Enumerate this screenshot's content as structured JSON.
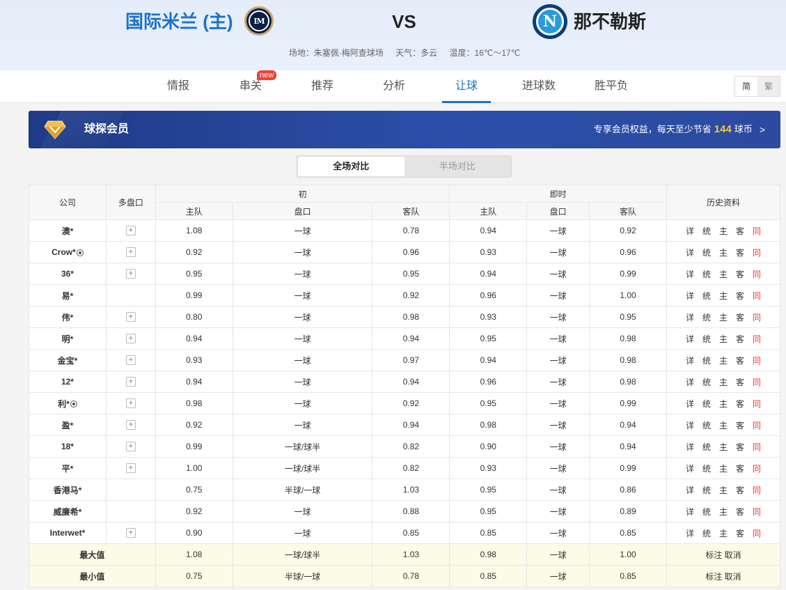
{
  "header": {
    "home_team": "国际米兰 (主)",
    "away_team": "那不勒斯",
    "vs": "VS",
    "home_logo_text": "IM",
    "away_logo_text": "N",
    "venue": "场地：朱塞佩·梅阿查球场",
    "weather": "天气：多云",
    "temperature": "温度：16℃～17℃"
  },
  "nav": {
    "tabs": [
      "情报",
      "串关",
      "推荐",
      "分析",
      "让球",
      "进球数",
      "胜平负"
    ],
    "active_tab": "让球",
    "new_badge": "new",
    "lang_simplified": "简",
    "lang_traditional": "繁"
  },
  "member": {
    "title": "球探会员",
    "text_prefix": "专享会员权益，每天至少节省",
    "coins": "144",
    "text_suffix": "球币",
    "arrow": ">"
  },
  "segment": {
    "full": "全场对比",
    "half": "半场对比"
  },
  "table": {
    "headers": {
      "company": "公司",
      "multi": "多盘口",
      "initial": "初",
      "live": "即时",
      "home": "主队",
      "line": "盘口",
      "away": "客队",
      "history": "历史资料"
    },
    "history_links": [
      "详",
      "统",
      "主",
      "客",
      "同"
    ],
    "rows": [
      {
        "company": "澳*",
        "ball": false,
        "plus": true,
        "i_home": "1.08",
        "i_line": "一球",
        "i_away": "0.78",
        "l_home": "0.94",
        "l_line": "一球",
        "l_away": "0.92"
      },
      {
        "company": "Crow*",
        "ball": true,
        "plus": true,
        "i_home": "0.92",
        "i_line": "一球",
        "i_away": "0.96",
        "l_home": "0.93",
        "l_line": "一球",
        "l_away": "0.96"
      },
      {
        "company": "36*",
        "ball": false,
        "plus": true,
        "i_home": "0.95",
        "i_line": "一球",
        "i_away": "0.95",
        "l_home": "0.94",
        "l_line": "一球",
        "l_away": "0.99"
      },
      {
        "company": "易*",
        "ball": false,
        "plus": false,
        "i_home": "0.99",
        "i_line": "一球",
        "i_away": "0.92",
        "l_home": "0.96",
        "l_line": "一球",
        "l_away": "1.00"
      },
      {
        "company": "伟*",
        "ball": false,
        "plus": true,
        "i_home": "0.80",
        "i_line": "一球",
        "i_away": "0.98",
        "l_home": "0.93",
        "l_line": "一球",
        "l_away": "0.95"
      },
      {
        "company": "明*",
        "ball": false,
        "plus": true,
        "i_home": "0.94",
        "i_line": "一球",
        "i_away": "0.94",
        "l_home": "0.95",
        "l_line": "一球",
        "l_away": "0.98"
      },
      {
        "company": "金宝*",
        "ball": false,
        "plus": true,
        "i_home": "0.93",
        "i_line": "一球",
        "i_away": "0.97",
        "l_home": "0.94",
        "l_line": "一球",
        "l_away": "0.98"
      },
      {
        "company": "12*",
        "ball": false,
        "plus": true,
        "i_home": "0.94",
        "i_line": "一球",
        "i_away": "0.94",
        "l_home": "0.96",
        "l_line": "一球",
        "l_away": "0.98"
      },
      {
        "company": "利*",
        "ball": true,
        "plus": true,
        "i_home": "0.98",
        "i_line": "一球",
        "i_away": "0.92",
        "l_home": "0.95",
        "l_line": "一球",
        "l_away": "0.99"
      },
      {
        "company": "盈*",
        "ball": false,
        "plus": true,
        "i_home": "0.92",
        "i_line": "一球",
        "i_away": "0.94",
        "l_home": "0.98",
        "l_line": "一球",
        "l_away": "0.94"
      },
      {
        "company": "18*",
        "ball": false,
        "plus": true,
        "i_home": "0.99",
        "i_line": "一球/球半",
        "i_away": "0.82",
        "l_home": "0.90",
        "l_line": "一球",
        "l_away": "0.94"
      },
      {
        "company": "平*",
        "ball": false,
        "plus": true,
        "i_home": "1.00",
        "i_line": "一球/球半",
        "i_away": "0.82",
        "l_home": "0.93",
        "l_line": "一球",
        "l_away": "0.99"
      },
      {
        "company": "香港马*",
        "ball": false,
        "plus": false,
        "i_home": "0.75",
        "i_line": "半球/一球",
        "i_away": "1.03",
        "l_home": "0.95",
        "l_line": "一球",
        "l_away": "0.86"
      },
      {
        "company": "威廉希*",
        "ball": false,
        "plus": false,
        "i_home": "0.92",
        "i_line": "一球",
        "i_away": "0.88",
        "l_home": "0.95",
        "l_line": "一球",
        "l_away": "0.89"
      },
      {
        "company": "Interwet*",
        "ball": false,
        "plus": true,
        "i_home": "0.90",
        "i_line": "一球",
        "i_away": "0.85",
        "l_home": "0.85",
        "l_line": "一球",
        "l_away": "0.85"
      }
    ],
    "summary": [
      {
        "label": "最大值",
        "i_home": "1.08",
        "i_line": "一球/球半",
        "i_away": "1.03",
        "l_home": "0.98",
        "l_line": "一球",
        "l_away": "1.00",
        "action": "标注 取消"
      },
      {
        "label": "最小值",
        "i_home": "0.75",
        "i_line": "半球/一球",
        "i_away": "0.78",
        "l_home": "0.85",
        "l_line": "一球",
        "l_away": "0.85",
        "action": "标注 取消"
      }
    ]
  },
  "colors": {
    "accent": "#1a73c9",
    "header_bg": "#e6eefa",
    "banner_bg": "#2a4aa0",
    "coin": "#f7c64a",
    "same_link": "#e53935",
    "summary_bg": "#fbfbe8"
  }
}
